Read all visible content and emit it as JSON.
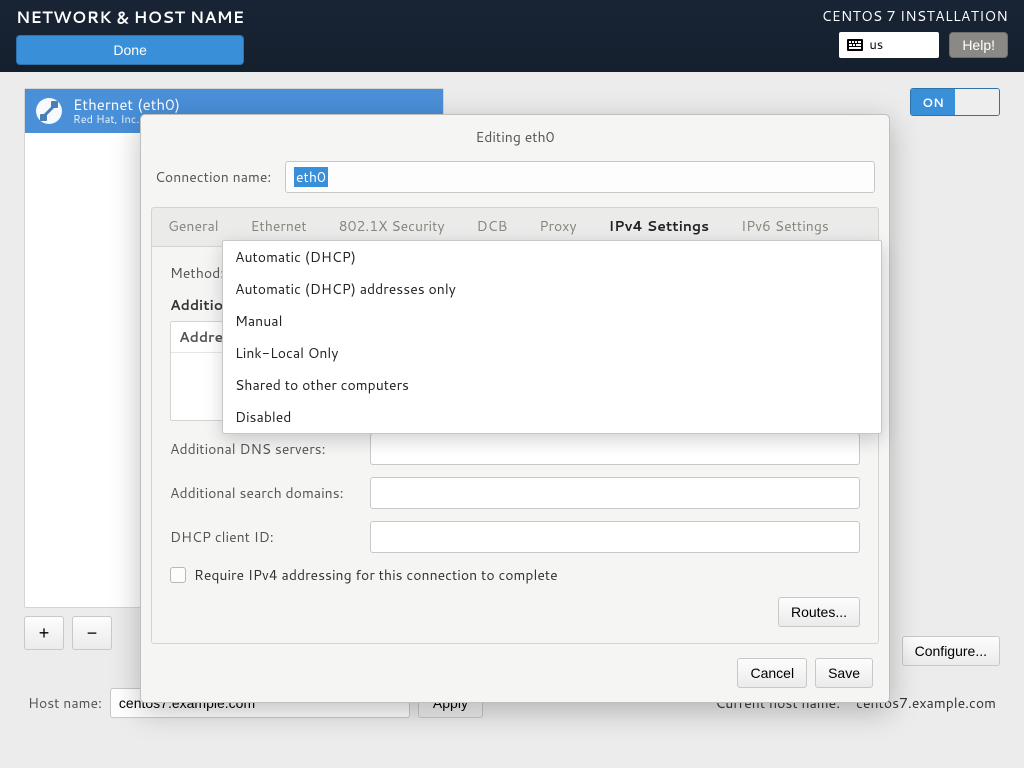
{
  "header": {
    "title": "NETWORK & HOST NAME",
    "done": "Done",
    "brand": "CENTOS 7 INSTALLATION",
    "kb_layout": "us",
    "help": "Help!"
  },
  "device": {
    "name": "Ethernet (eth0)",
    "vendor": "Red Hat, Inc. Vi",
    "switch_on": "ON"
  },
  "toolbar": {
    "plus": "+",
    "minus": "−",
    "configure": "Configure..."
  },
  "hostname": {
    "label": "Host name:",
    "value": "centos7.example.com",
    "apply": "Apply",
    "current_label": "Current host name:",
    "current_value": "centos7.example.com"
  },
  "modal": {
    "title": "Editing eth0",
    "conn_label": "Connection name:",
    "conn_value": "eth0",
    "tabs": [
      "General",
      "Ethernet",
      "802.1X Security",
      "DCB",
      "Proxy",
      "IPv4 Settings",
      "IPv6 Settings"
    ],
    "active_tab": "IPv4 Settings",
    "method_label": "Method:",
    "addresses_heading": "Additional",
    "table_header": "Addre",
    "dns_label": "Additional DNS servers:",
    "search_label": "Additional search domains:",
    "dhcp_id_label": "DHCP client ID:",
    "require_label": "Require IPv4 addressing for this connection to complete",
    "routes": "Routes...",
    "cancel": "Cancel",
    "save": "Save"
  },
  "method_options": [
    "Automatic (DHCP)",
    "Automatic (DHCP) addresses only",
    "Manual",
    "Link-Local Only",
    "Shared to other computers",
    "Disabled"
  ]
}
